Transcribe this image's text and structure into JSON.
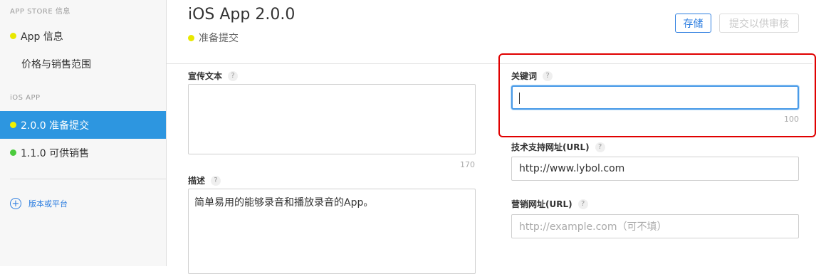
{
  "sidebar": {
    "section_app_store": "APP STORE 信息",
    "items_app_store": [
      {
        "label": "App 信息",
        "dot_color": "#e8e800"
      },
      {
        "label": "价格与销售范围"
      }
    ],
    "section_ios": "iOS APP",
    "items_ios": [
      {
        "label": "2.0.0 准备提交",
        "dot_color": "#f2f200",
        "active": true
      },
      {
        "label": "1.1.0 可供销售",
        "dot_color": "#4ccb3d"
      }
    ],
    "add_platform": "版本或平台"
  },
  "header": {
    "title": "iOS App 2.0.0",
    "status": "准备提交",
    "status_dot_color": "#e8e800",
    "save_label": "存储",
    "submit_label": "提交以供审核"
  },
  "form": {
    "promo_text": {
      "label": "宣传文本",
      "value": "",
      "counter": "170"
    },
    "description": {
      "label": "描述",
      "value": "简单易用的能够录音和播放录音的App。"
    },
    "keywords": {
      "label": "关键词",
      "value": "",
      "counter": "100"
    },
    "support_url": {
      "label": "技术支持网址(URL)",
      "value": "http://www.lybol.com"
    },
    "marketing_url": {
      "label": "营销网址(URL)",
      "placeholder": "http://example.com（可不填）"
    },
    "help_glyph": "?"
  },
  "colors": {
    "accent": "#2d7ee0",
    "active_nav": "#2d96e0",
    "annotation_red": "#e00000"
  }
}
